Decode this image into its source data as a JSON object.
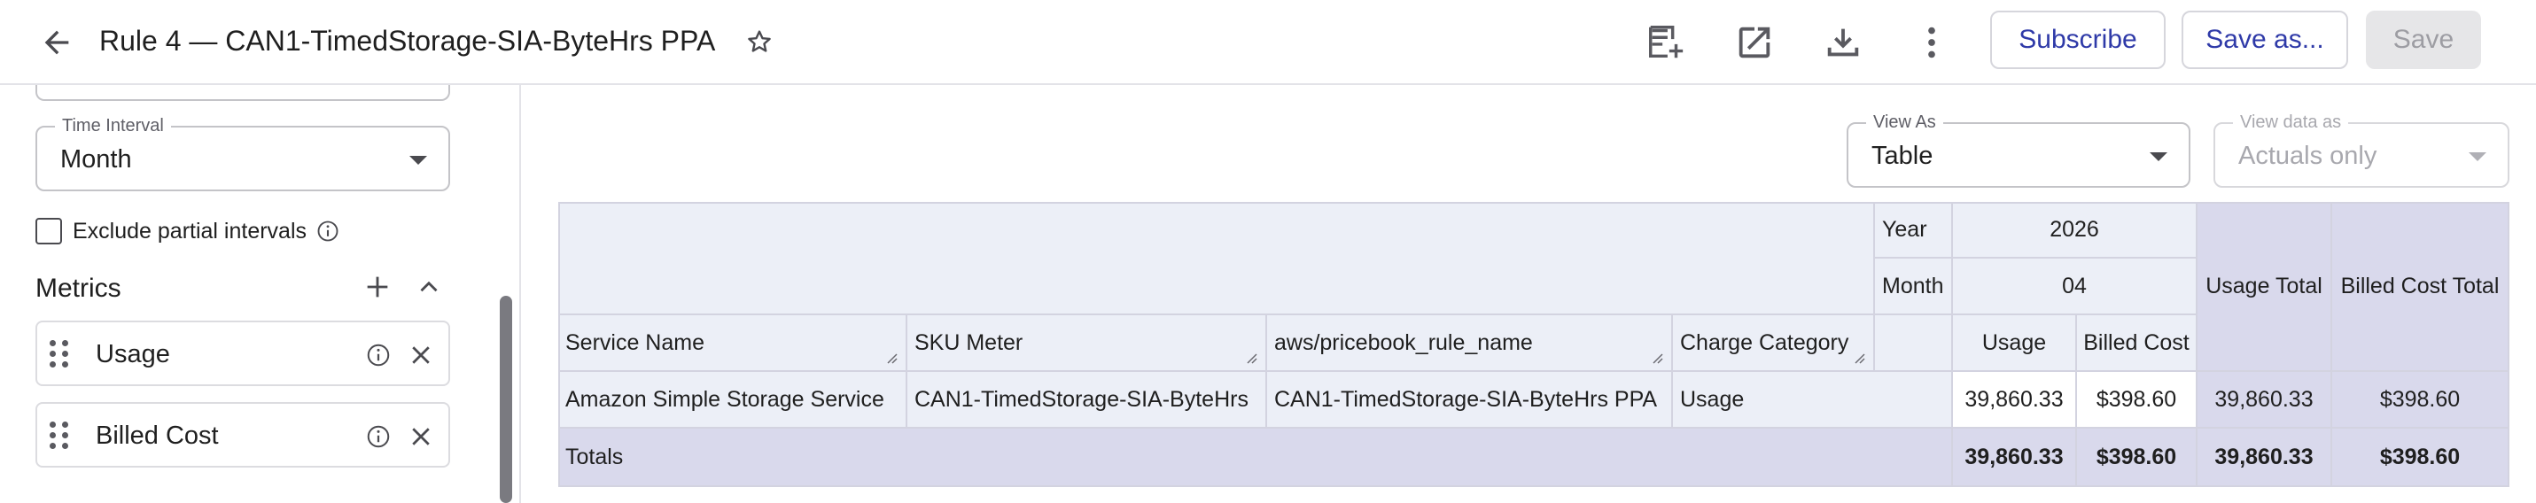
{
  "header": {
    "title": "Rule 4 — CAN1-TimedStorage-SIA-ByteHrs PPA",
    "subscribe_label": "Subscribe",
    "save_as_label": "Save as...",
    "save_label": "Save",
    "icons": [
      "arrow-left-icon",
      "star-outline-icon",
      "add-to-dashboard-icon",
      "open-in-new-icon",
      "download-icon",
      "more-vertical-icon"
    ]
  },
  "sidebar": {
    "time_interval": {
      "label": "Time Interval",
      "value": "Month"
    },
    "exclude_partial": {
      "label": "Exclude partial intervals",
      "checked": false
    },
    "metrics": {
      "title": "Metrics",
      "items": [
        {
          "label": "Usage"
        },
        {
          "label": "Billed Cost"
        }
      ]
    }
  },
  "main": {
    "view_as": {
      "label": "View As",
      "value": "Table"
    },
    "view_data_as": {
      "label": "View data as",
      "value": "Actuals only",
      "disabled": true
    }
  },
  "table": {
    "pivot_headers": {
      "year_label": "Year",
      "year_value": "2026",
      "month_label": "Month",
      "month_value": "04",
      "usage_total": "Usage Total",
      "billed_cost_total": "Billed Cost Total"
    },
    "columns": [
      "Service Name",
      "SKU Meter",
      "aws/pricebook_rule_name",
      "Charge Category"
    ],
    "metric_columns": [
      "Usage",
      "Billed Cost"
    ],
    "rows": [
      {
        "service_name": "Amazon Simple Storage Service",
        "sku_meter": "CAN1-TimedStorage-SIA-ByteHrs",
        "rule_name": "CAN1-TimedStorage-SIA-ByteHrs PPA",
        "charge_category": "Usage",
        "usage": "39,860.33",
        "billed_cost": "$398.60",
        "usage_total": "39,860.33",
        "billed_cost_total": "$398.60"
      }
    ],
    "totals": {
      "label": "Totals",
      "usage": "39,860.33",
      "billed_cost": "$398.60",
      "usage_total": "39,860.33",
      "billed_cost_total": "$398.60"
    }
  },
  "colors": {
    "accent": "#2f3aa8",
    "header_bg": "#eceff7",
    "total_bg": "#d9d9ec",
    "border": "#d3d3e0"
  }
}
